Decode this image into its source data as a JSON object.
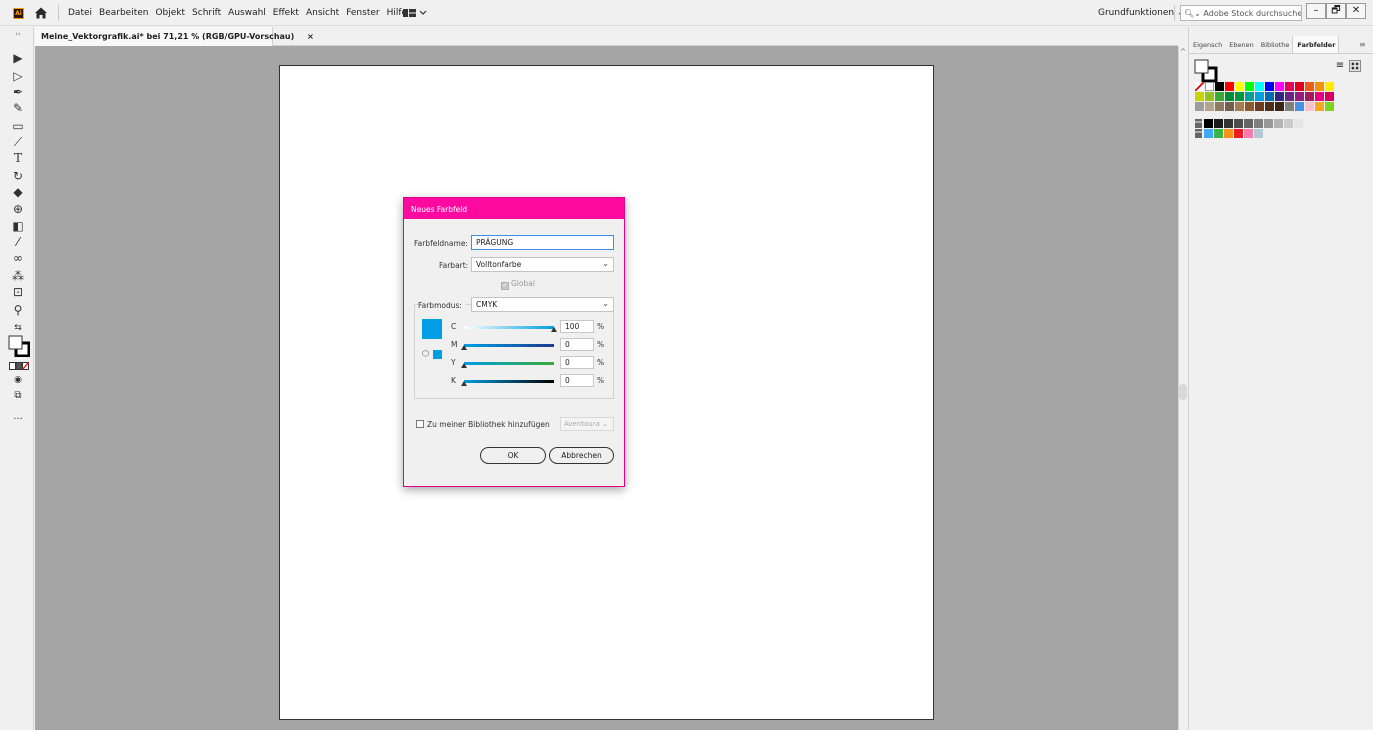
{
  "app": {
    "logo_text": "Ai",
    "menu": [
      "Datei",
      "Bearbeiten",
      "Objekt",
      "Schrift",
      "Auswahl",
      "Effekt",
      "Ansicht",
      "Fenster",
      "Hilfe"
    ],
    "workspace": "Grundfunktionen ⌄",
    "stock_search_placeholder": "Adobe Stock durchsuchen",
    "window_buttons": {
      "minimize": "–",
      "restore": "🗗",
      "close": "✕"
    }
  },
  "document": {
    "tab_title": "Meine_Vektorgrafik.ai* bei 71,21 % (RGB/GPU-Vorschau)",
    "tab_close": "×"
  },
  "toolbar": {
    "tools": [
      "selection-tool",
      "direct-selection-tool",
      "pen-tool",
      "curvature-tool",
      "rectangle-tool",
      "paintbrush-tool",
      "type-tool",
      "rotate-tool",
      "eraser-tool",
      "shape-builder-tool",
      "gradient-tool",
      "eyedropper-tool",
      "blend-tool",
      "symbol-sprayer-tool",
      "artboard-tool",
      "zoom-tool",
      "swap-fill-stroke",
      "fill-stroke",
      "color-modes",
      "draw-modes",
      "screen-mode",
      "edit-toolbar"
    ],
    "more": "···"
  },
  "panel": {
    "tabs": [
      "Eigensch",
      "Ebenen",
      "Bibliothe",
      "Farbfelder"
    ],
    "active_tab": "Farbfelder",
    "menu_icon": "≡",
    "swatch_rows": [
      [
        "#ff0000",
        "#ffffff",
        "#000000",
        "#ff0000",
        "#ffff00",
        "#00ff00",
        "#00ffff",
        "#0000ff",
        "#ff00ff",
        "#e5005a",
        "#e2001a",
        "#e85c1a",
        "#f39200",
        "#ffed00"
      ],
      [
        "#c6d400",
        "#95c11f",
        "#3aaa35",
        "#008d36",
        "#00963f",
        "#00a19a",
        "#009fe3",
        "#0069b4",
        "#312783",
        "#662483",
        "#951b81",
        "#a3195b",
        "#e6007e",
        "#d6005f"
      ],
      [
        "#9d9d9c",
        "#b5a48c",
        "#8c7a62",
        "#6f5f4c",
        "#a67c52",
        "#8b5a2b",
        "#6f3c1f",
        "#4e2e1a",
        "#3b2414",
        "#808080",
        "#4a90e2",
        "#ffc0cb",
        "#f5a623",
        "#7ed321"
      ],
      [
        "#000000",
        "#1a1a1a",
        "#333333",
        "#4d4d4d",
        "#666666",
        "#808080",
        "#999999",
        "#b3b3b3",
        "#cccccc",
        "#e6e6e6"
      ],
      [
        "#3fa9f5",
        "#39b54a",
        "#f7931e",
        "#ed1c24",
        "#ff7bac",
        "#b3c7d6"
      ]
    ]
  },
  "dialog": {
    "title": "Neues Farbfeld",
    "name_label": "Farbfeldname:",
    "name_value": "PRÄGUNG",
    "type_label": "Farbart:",
    "type_value": "Volltonfarbe",
    "global_label": "Global",
    "mode_label": "Farbmodus:",
    "mode_value": "CMYK",
    "preview_color": "#009fe3",
    "channels": [
      {
        "label": "C",
        "value": "100",
        "fraction": 1.0,
        "gradient": [
          "#ffffff",
          "#009fe3"
        ]
      },
      {
        "label": "M",
        "value": "0",
        "fraction": 0.0,
        "gradient": [
          "#009fe3",
          "#1d3a8f"
        ]
      },
      {
        "label": "Y",
        "value": "0",
        "fraction": 0.0,
        "gradient": [
          "#009fe3",
          "#3aaa35"
        ]
      },
      {
        "label": "K",
        "value": "0",
        "fraction": 0.0,
        "gradient": [
          "#009fe3",
          "#000000"
        ]
      }
    ],
    "percent": "%",
    "library_label": "Zu meiner Bibliothek hinzufügen",
    "library_value": "Aventoura ⌄",
    "ok_label": "OK",
    "cancel_label": "Abbrechen"
  }
}
